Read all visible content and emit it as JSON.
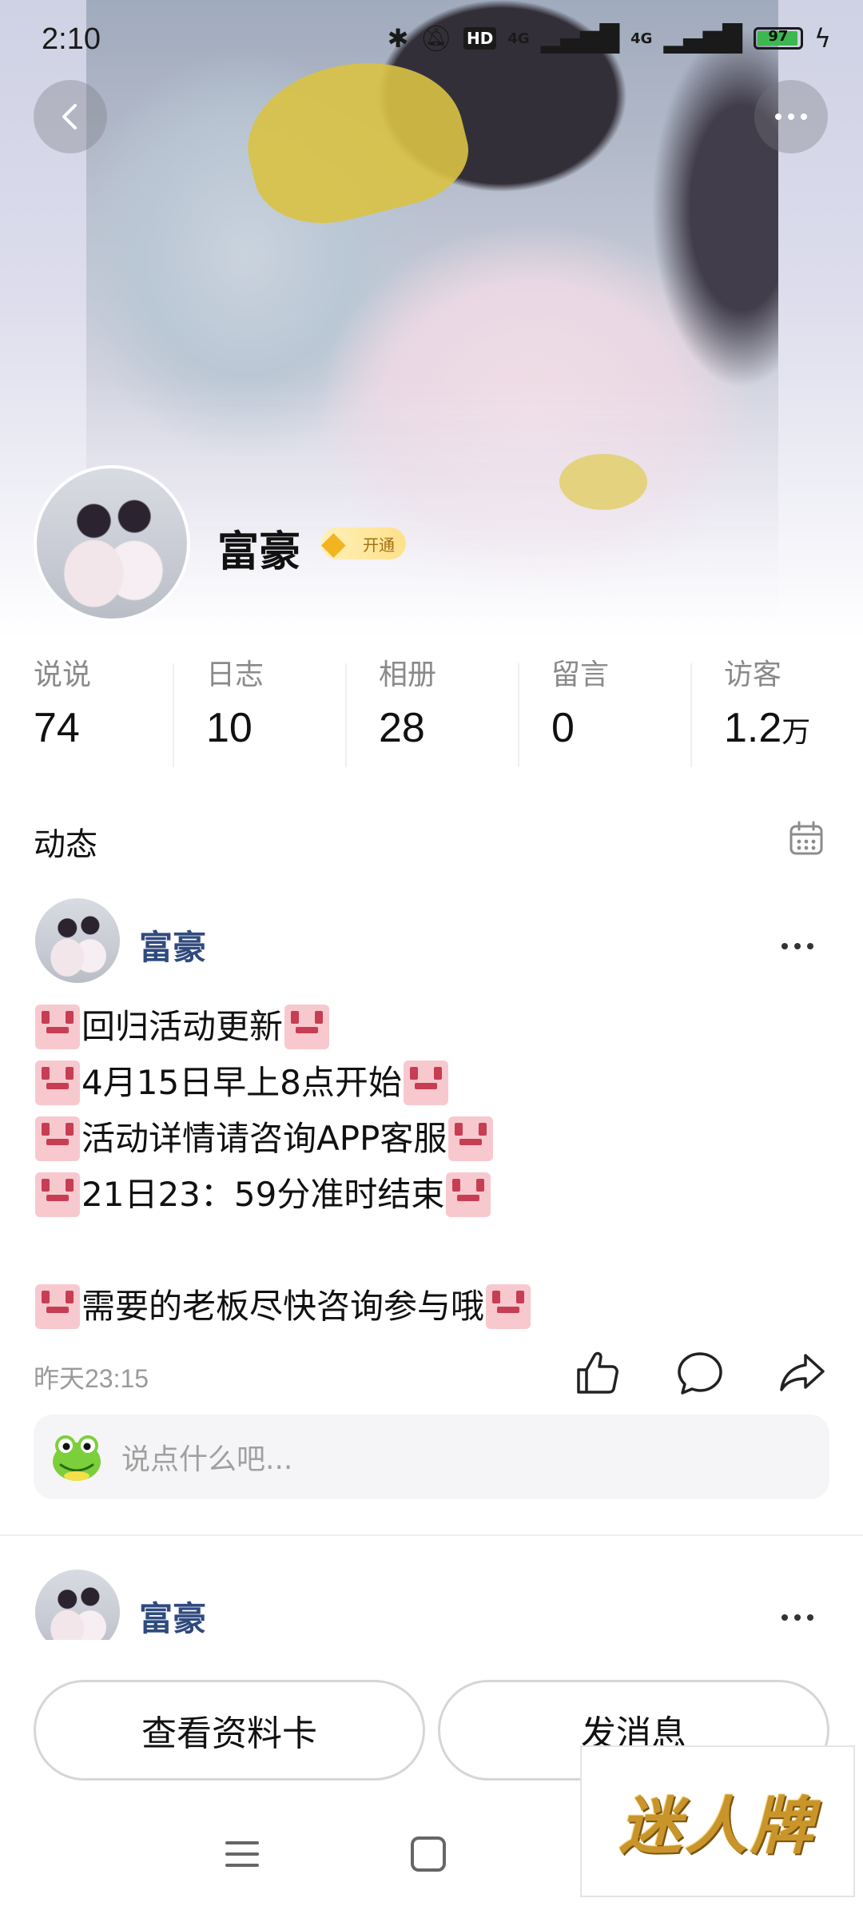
{
  "status_bar": {
    "time": "2:10",
    "icons": [
      "bluetooth-icon",
      "mute-icon",
      "hd-icon",
      "signal-icon",
      "signal-icon",
      "battery-icon",
      "charging-icon"
    ],
    "hd_label": "HD",
    "network_1": "4G",
    "network_2": "4G",
    "battery_level": "97"
  },
  "header": {
    "back_icon": "chevron-left-icon",
    "more_icon": "more-icon"
  },
  "profile": {
    "name": "富豪",
    "vip_label": "开通"
  },
  "stats": [
    {
      "label": "说说",
      "value": "74",
      "unit": ""
    },
    {
      "label": "日志",
      "value": "10",
      "unit": ""
    },
    {
      "label": "相册",
      "value": "28",
      "unit": ""
    },
    {
      "label": "留言",
      "value": "0",
      "unit": ""
    },
    {
      "label": "访客",
      "value": "1.2",
      "unit": "万"
    }
  ],
  "feed": {
    "title": "动态",
    "calendar_icon": "calendar-icon"
  },
  "post": {
    "author": "富豪",
    "lines": [
      "回归活动更新",
      "4月15日早上8点开始",
      "活动详情请咨询APP客服",
      "21日23：59分准时结束",
      "",
      "需要的老板尽快咨询参与哦"
    ],
    "time": "昨天23:15",
    "comment_placeholder": "说点什么吧..."
  },
  "post2": {
    "author": "富豪"
  },
  "bottom_bar": {
    "profile_card_label": "查看资料卡",
    "message_label": "发消息"
  },
  "watermark": {
    "text": "迷人牌"
  },
  "colors": {
    "author_name": "#2f4a7e",
    "vip_gold": "#f2b420",
    "battery_green": "#3db84f"
  }
}
